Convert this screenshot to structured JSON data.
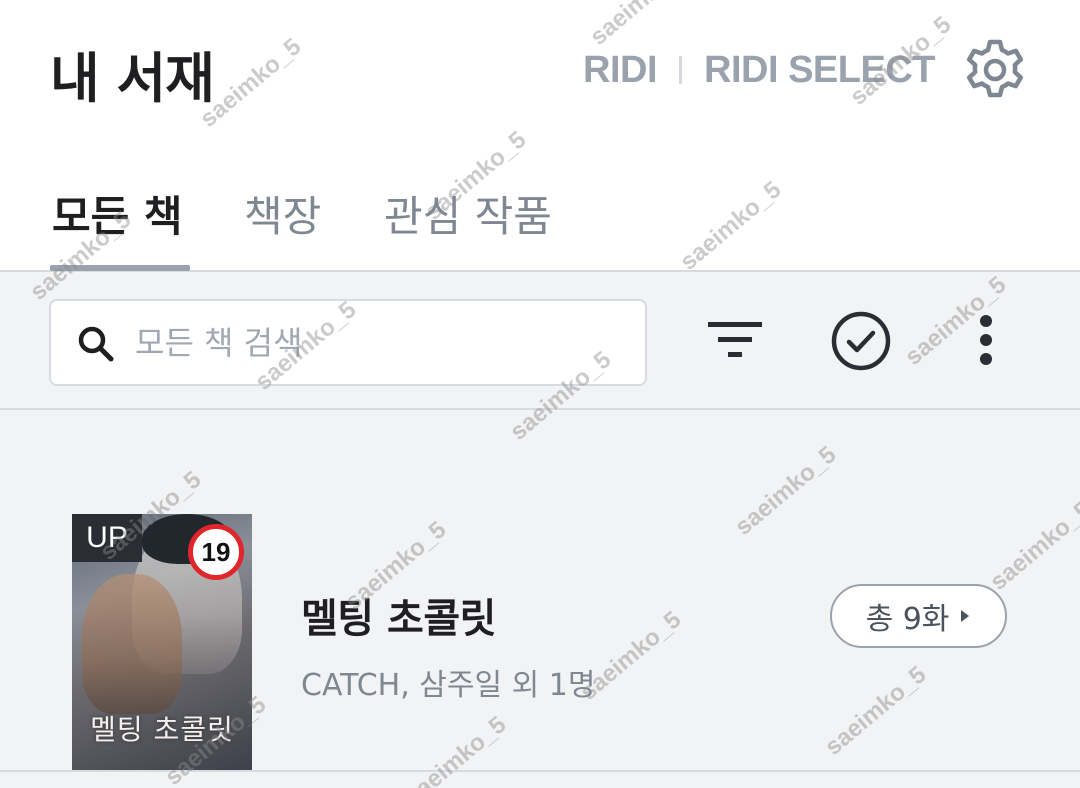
{
  "header": {
    "title": "내 서재",
    "brand_ridi": "RIDI",
    "brand_select": "RIDI SELECT",
    "settings_icon": "gear-icon"
  },
  "tabs": [
    {
      "label": "모든 책",
      "active": true
    },
    {
      "label": "책장",
      "active": false
    },
    {
      "label": "관심 작품",
      "active": false
    }
  ],
  "toolbar": {
    "search_placeholder": "모든 책 검색",
    "search_value": "",
    "filter_icon": "filter-icon",
    "select_icon": "check-circle-icon",
    "more_icon": "more-vertical-icon"
  },
  "books": [
    {
      "title": "멜팅 초콜릿",
      "author": "CATCH, 삼주일 외 1명",
      "cover_title": "멜팅 초콜릿",
      "update_badge": "UP",
      "age_badge": "19",
      "episodes_label": "총 9화"
    }
  ],
  "watermark": "saeimko_5",
  "colors": {
    "text_primary": "#1f1f21",
    "text_secondary": "#7e8792",
    "brand_gray": "#99a2ad",
    "background_gray": "#f2f3f5",
    "divider": "#d7dbe0",
    "age_badge_red": "#e0262d"
  }
}
